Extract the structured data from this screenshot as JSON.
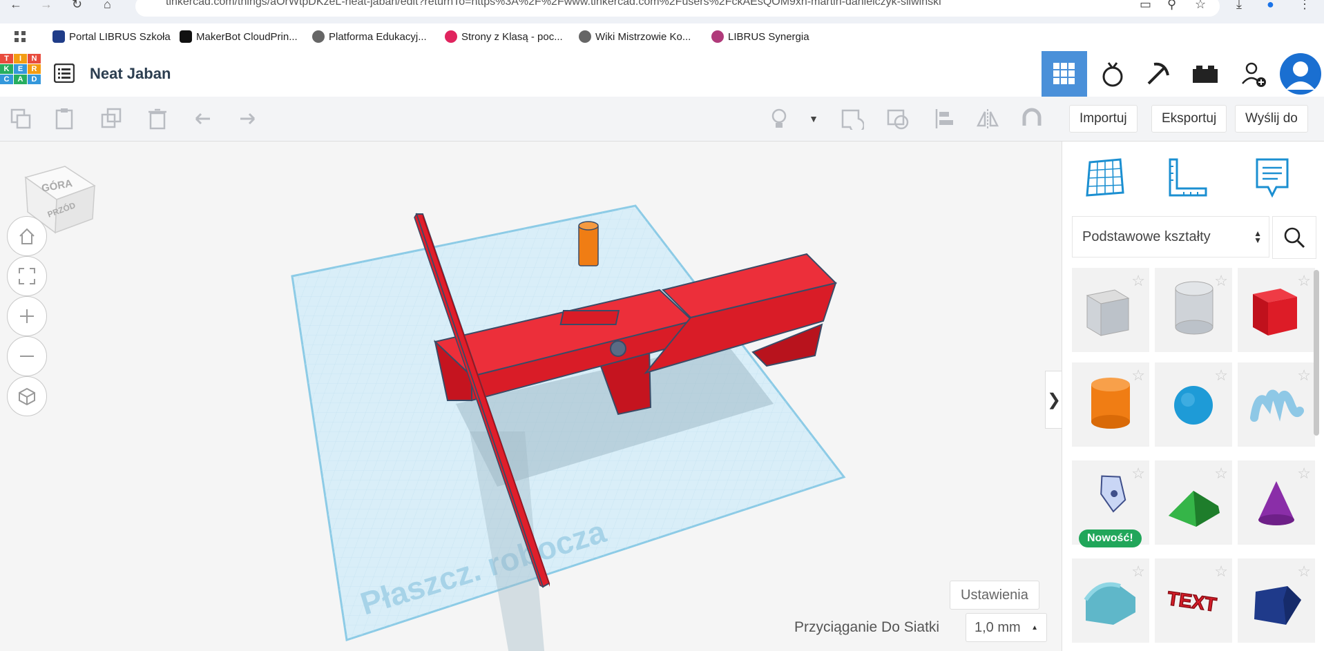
{
  "browser": {
    "url": "tinkercad.com/things/aOrWtpDKzeL-neat-jaban/edit?returnTo=https%3A%2F%2Fwww.tinkercad.com%2Fusers%2FckAEsQOM9xn-martin-danielczyk-sliwinski",
    "bookmarks": [
      {
        "label": "Portal LIBRUS Szkoła",
        "color": "#1f3c88"
      },
      {
        "label": "MakerBot CloudPrin...",
        "color": "#111111"
      },
      {
        "label": "Platforma Edukacyj...",
        "color": "#666666"
      },
      {
        "label": "Strony z Klasą - poc...",
        "color": "#e0245e"
      },
      {
        "label": "Wiki Mistrzowie Ko...",
        "color": "#666666"
      },
      {
        "label": "LIBRUS Synergia",
        "color": "#b03a7a"
      }
    ]
  },
  "header": {
    "logo_letters": [
      "T",
      "I",
      "N",
      "K",
      "E",
      "R",
      "C",
      "A",
      "D"
    ],
    "title": "Neat Jaban"
  },
  "toolbar": {
    "import_label": "Importuj",
    "export_label": "Eksportuj",
    "send_label": "Wyślij do"
  },
  "viewcube": {
    "top": "GÓRA",
    "front": "PRZÓD"
  },
  "workplane": {
    "label": "Płaszcz. robocza"
  },
  "bottom": {
    "settings_label": "Ustawienia",
    "snap_label": "Przyciąganie Do Siatki",
    "snap_value": "1,0 mm"
  },
  "panel": {
    "category": "Podstawowe kształty",
    "new_badge": "Nowość!",
    "shapes": [
      {
        "name": "box-hole"
      },
      {
        "name": "cylinder-hole"
      },
      {
        "name": "box"
      },
      {
        "name": "cylinder"
      },
      {
        "name": "sphere"
      },
      {
        "name": "scribble"
      },
      {
        "name": "sketch"
      },
      {
        "name": "roof"
      },
      {
        "name": "cone"
      },
      {
        "name": "round-roof"
      },
      {
        "name": "text"
      },
      {
        "name": "polygon"
      }
    ]
  },
  "colors": {
    "accent": "#4a90d9",
    "red": "#e01e2a",
    "orange": "#f07d14",
    "workplane": "#d9eef8"
  }
}
